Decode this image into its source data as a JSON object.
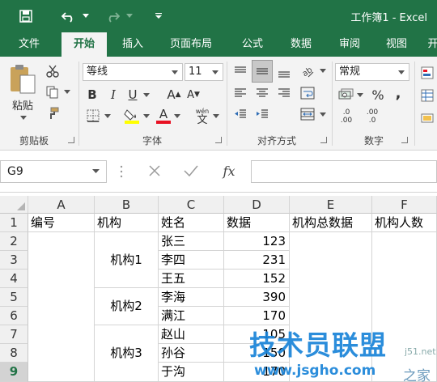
{
  "window": {
    "title": "工作簿1 - Excel"
  },
  "tabs": [
    "文件",
    "开始",
    "插入",
    "页面布局",
    "公式",
    "数据",
    "审阅",
    "视图",
    "开"
  ],
  "ribbon": {
    "clipboard": {
      "paste_label": "粘贴",
      "group_label": "剪贴板"
    },
    "font": {
      "name": "等线",
      "size": "11",
      "bold": "B",
      "italic": "I",
      "underline": "U",
      "grow": "A",
      "shrink": "A",
      "font_color": "A",
      "phonetic": "wén",
      "phonetic_char": "文",
      "group_label": "字体"
    },
    "alignment": {
      "group_label": "对齐方式"
    },
    "number": {
      "format": "常规",
      "percent": "%",
      "comma": ",",
      "inc_decimal": ".0",
      "inc_decimal2": ".00",
      "dec_decimal": ".00",
      "dec_decimal2": ".0",
      "group_label": "数字"
    },
    "colors": {
      "brand": "#217346",
      "fill": "#ffff00",
      "font_red": "#e81123"
    }
  },
  "formula_bar": {
    "name_box": "G9",
    "fx": "fx"
  },
  "sheet": {
    "columns": [
      "A",
      "B",
      "C",
      "D",
      "E",
      "F"
    ],
    "rows": [
      "1",
      "2",
      "3",
      "4",
      "5",
      "6",
      "7",
      "8",
      "9"
    ],
    "selected_row": "9",
    "headers": [
      "编号",
      "机构",
      "姓名",
      "数据",
      "机构总数据",
      "机构人数"
    ],
    "groups": [
      "机构1",
      "机构2",
      "机构3"
    ],
    "names": [
      "张三",
      "李四",
      "王五",
      "李海",
      "满江",
      "赵山",
      "孙谷",
      "于沟"
    ],
    "values": [
      "123",
      "231",
      "152",
      "390",
      "170",
      "105",
      "150",
      "170"
    ]
  },
  "watermark": {
    "title": "技术员联盟",
    "url": "www.jsgho.com",
    "side": "j51.net",
    "corner": "之家"
  }
}
